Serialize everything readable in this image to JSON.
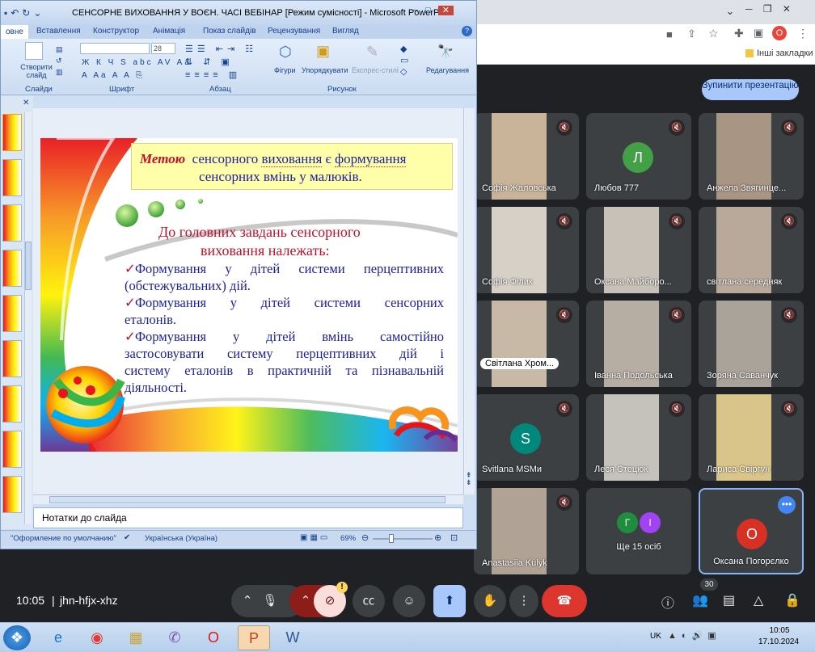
{
  "ppt": {
    "title": "СЕНСОРНЕ ВИХОВАННЯ У ВОЄН. ЧАСІ ВЕБІНАР [Режим сумісності] - Microsoft PowerPoint",
    "tabs": [
      "овне",
      "Вставлення",
      "Конструктор",
      "Анімація",
      "Показ слайдів",
      "Рецензування",
      "Вигляд"
    ],
    "groups": {
      "slides": "Слайди",
      "font": "Шрифт",
      "paragraph": "Абзац",
      "drawing": "Рисунок"
    },
    "buttons": {
      "new_slide": "Створити слайд",
      "shapes": "Фігури",
      "arrange": "Упорядкувати",
      "quick_styles": "Експрес-стилі",
      "editing": "Редагування"
    },
    "font_size": "28",
    "slide": {
      "box_red": "Метою",
      "box_rest1": "сенсорного",
      "box_rest2": "виховання",
      "box_rest3": "є",
      "box_rest4": "формування",
      "box_line2": "сенсорних вмінь у малюків.",
      "heading1": "До головних завдань сенсорного",
      "heading2": "виховання належать:",
      "item1a": "Формування у дітей системи перцептивних",
      "item1b": "(обстежувальних) дій.",
      "item2a": "Формування у дітей системи сенсорних",
      "item2b": "еталонів.",
      "item3a": "Формування у дітей вмінь самостійно",
      "item3b": "застосовувати систему перцептивних дій і",
      "item3c": "систему еталонів в практичній та пізнавальній",
      "item3d": "діяльності."
    },
    "notes": "Нотатки до слайда",
    "status": {
      "theme": "\"Оформление по умолчанию\"",
      "lang": "Українська (Україна)",
      "zoom": "69%"
    }
  },
  "chrome": {
    "bookmarks": "Інші закладки",
    "profile": "О"
  },
  "meet": {
    "stop_present": "Зупинити презентацію",
    "tiles": [
      {
        "name": "Софія Жаловська"
      },
      {
        "name": "Любов 777",
        "initial": "Л",
        "color": "#43a047"
      },
      {
        "name": "Анжела Звягинце..."
      },
      {
        "name": "Софія Фiлик"
      },
      {
        "name": "Оксана Майборо..."
      },
      {
        "name": "світлана середняк"
      },
      {
        "name": "Світлана Хром..."
      },
      {
        "name": "Іванна Подольська"
      },
      {
        "name": "Зоряна Саванчук"
      },
      {
        "name": "Svitlana MSMи",
        "initial": "S",
        "color": "#00897b"
      },
      {
        "name": "Леся Стецюк"
      },
      {
        "name": "Лариса Свiргун"
      },
      {
        "name": "Anastasiia Kulyk"
      },
      {
        "name": "Ще 15 осіб",
        "i1": "Г",
        "i2": "І"
      },
      {
        "name": "Оксана Погорєлко",
        "initial": "О",
        "color": "#d93025"
      }
    ],
    "time": "10:05",
    "code": "jhn-hfjx-xhz",
    "people_count": "30"
  },
  "taskbar": {
    "lang": "UK",
    "clock_time": "10:05",
    "clock_date": "17.10.2024"
  }
}
